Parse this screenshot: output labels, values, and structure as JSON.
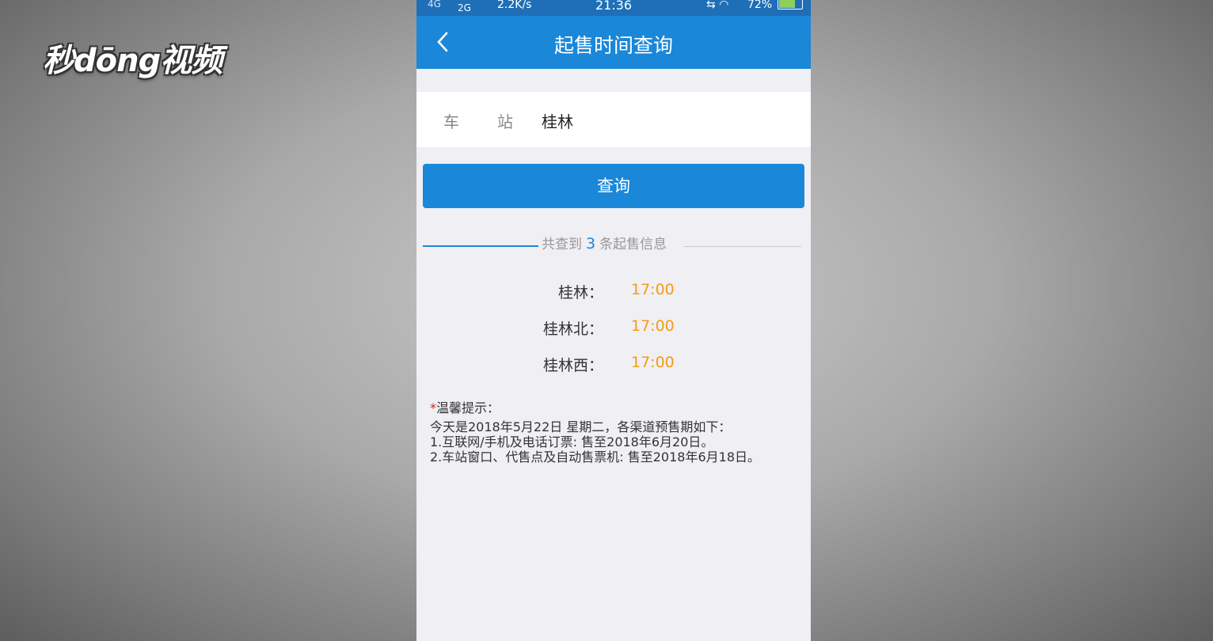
{
  "watermark": "秒dōng视频",
  "status_bar": {
    "signal": "4G",
    "network": "2G",
    "speed": "2.2K/s",
    "time": "21:36",
    "battery": "72%"
  },
  "nav": {
    "back_icon": "chevron-left",
    "title": "起售时间查询"
  },
  "station": {
    "label_char1": "车",
    "label_char2": "站",
    "value": "桂林"
  },
  "query_button": "查询",
  "result_summary": {
    "prefix": "共查到",
    "count": "3",
    "suffix": "条起售信息"
  },
  "sale_times": [
    {
      "station": "桂林：",
      "time": "17:00"
    },
    {
      "station": "桂林北：",
      "time": "17:00"
    },
    {
      "station": "桂林西：",
      "time": "17:00"
    }
  ],
  "tips": {
    "star": "*",
    "title": "温馨提示：",
    "lines": [
      "今天是2018年5月22日 星期二，各渠道预售期如下：",
      "1.互联网/手机及电话订票: 售至2018年6月20日。",
      "2.车站窗口、代售点及自动售票机: 售至2018年6月18日。"
    ]
  },
  "colors": {
    "nav_blue": "#1a87d9",
    "time_orange": "#f39c12"
  }
}
